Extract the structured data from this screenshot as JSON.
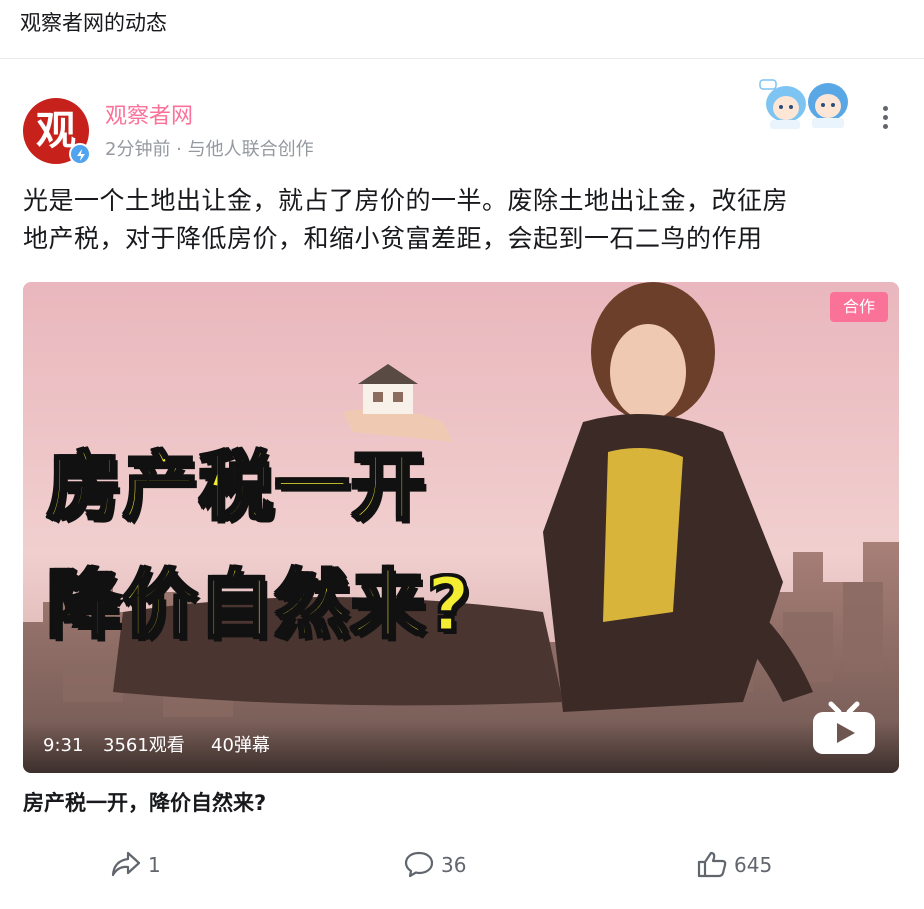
{
  "header": {
    "title": "观察者网的动态"
  },
  "post": {
    "avatar_char": "观",
    "author": "观察者网",
    "meta": "2分钟前 · 与他人联合创作",
    "text_lines": [
      "光是一个土地出让金，就占了房价的一半。废除土地出让金，改征房",
      "地产税，对于降低房价，和缩小贫富差距，会起到一石二鸟的作用"
    ]
  },
  "video": {
    "badge": "合作",
    "cover_line1": "房产税一开",
    "cover_line2": "降价自然来?",
    "duration": "9:31",
    "views": "3561观看",
    "danmaku": "40弹幕",
    "title": "房产税一开，降价自然来?"
  },
  "actions": {
    "share_count": "1",
    "comment_count": "36",
    "like_count": "645"
  },
  "colors": {
    "accent_pink": "#fb7299",
    "avatar_red": "#c7211c",
    "verify_blue": "#4fa3ef",
    "cover_text_yellow": "#f4ee33"
  },
  "icons": [
    "more-icon",
    "verify-icon",
    "share-icon",
    "comment-icon",
    "like-icon",
    "bilibili-play-logo"
  ]
}
